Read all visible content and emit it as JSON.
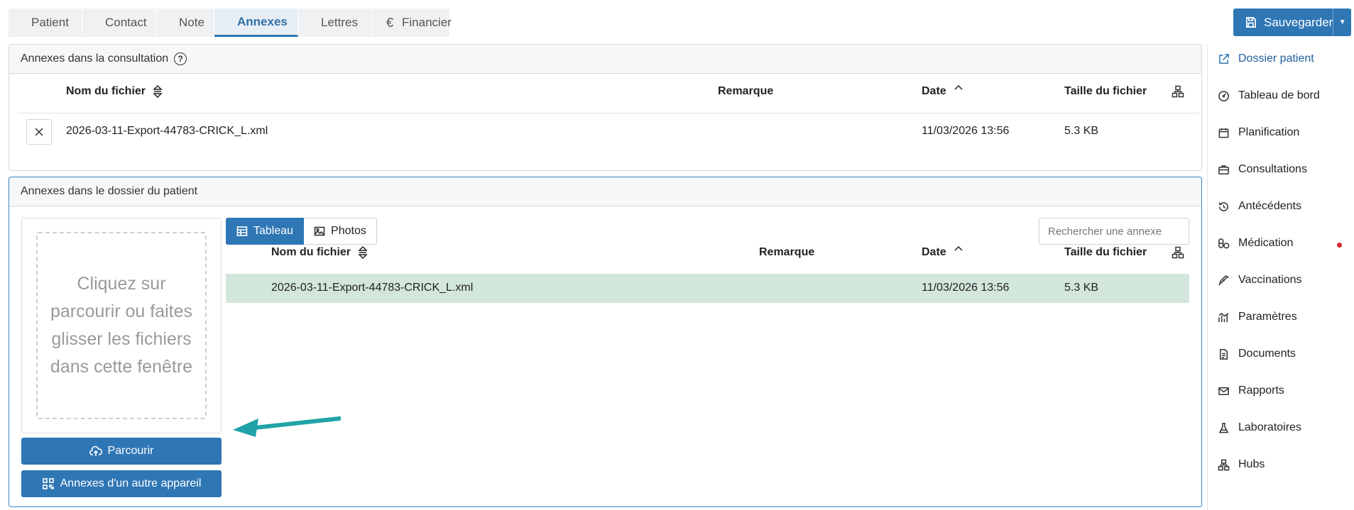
{
  "tabs": [
    {
      "label": "Patient",
      "icon": "user-icon"
    },
    {
      "label": "Contact",
      "icon": "contact-card-icon"
    },
    {
      "label": "Note",
      "icon": "chat-bubble-icon"
    },
    {
      "label": "Annexes",
      "icon": "paperclip-icon",
      "active": true
    },
    {
      "label": "Lettres",
      "icon": "letters-icon"
    },
    {
      "label": "Financier",
      "icon": "euro-icon"
    }
  ],
  "save_button": {
    "label": "Sauvegarder",
    "icon": "save-icon"
  },
  "consultation_panel": {
    "title": "Annexes dans la consultation",
    "columns": {
      "filename": "Nom du fichier",
      "remark": "Remarque",
      "date": "Date",
      "size": "Taille du fichier"
    },
    "rows": [
      {
        "filename": "2026-03-11-Export-44783-CRICK_L.xml",
        "remark": "",
        "date": "11/03/2026 13:56",
        "size": "5.3 KB"
      }
    ]
  },
  "patient_panel": {
    "title": "Annexes dans le dossier du patient",
    "drop_zone_text": "Cliquez sur parcourir ou faites glisser les fichiers dans cette fenêtre",
    "browse_label": "Parcourir",
    "other_device_label": "Annexes d'un autre appareil",
    "view_toggle": {
      "table": "Tableau",
      "photos": "Photos",
      "selected": "Tableau"
    },
    "search_placeholder": "Rechercher une annexe",
    "columns": {
      "filename": "Nom du fichier",
      "remark": "Remarque",
      "date": "Date",
      "size": "Taille du fichier"
    },
    "rows": [
      {
        "filename": "2026-03-11-Export-44783-CRICK_L.xml",
        "remark": "",
        "date": "11/03/2026 13:56",
        "size": "5.3 KB",
        "selected": true
      }
    ]
  },
  "sidebar": {
    "items": [
      {
        "label": "Dossier patient",
        "icon": "external-link-icon"
      },
      {
        "label": "Tableau de bord",
        "icon": "dashboard-icon"
      },
      {
        "label": "Planification",
        "icon": "calendar-icon"
      },
      {
        "label": "Consultations",
        "icon": "briefcase-icon"
      },
      {
        "label": "Antécédents",
        "icon": "history-icon"
      },
      {
        "label": "Médication",
        "icon": "pill-icon",
        "badge": "red-dot"
      },
      {
        "label": "Vaccinations",
        "icon": "syringe-icon"
      },
      {
        "label": "Paramètres",
        "icon": "chart-icon"
      },
      {
        "label": "Documents",
        "icon": "document-icon"
      },
      {
        "label": "Rapports",
        "icon": "mail-icon"
      },
      {
        "label": "Laboratoires",
        "icon": "flask-icon"
      },
      {
        "label": "Hubs",
        "icon": "hubs-icon"
      }
    ]
  },
  "colors": {
    "primary": "#2f76b5",
    "selected_row": "#d2e6dc",
    "annotation_arrow": "#1fa3a8",
    "notification_dot": "#e0242b"
  }
}
